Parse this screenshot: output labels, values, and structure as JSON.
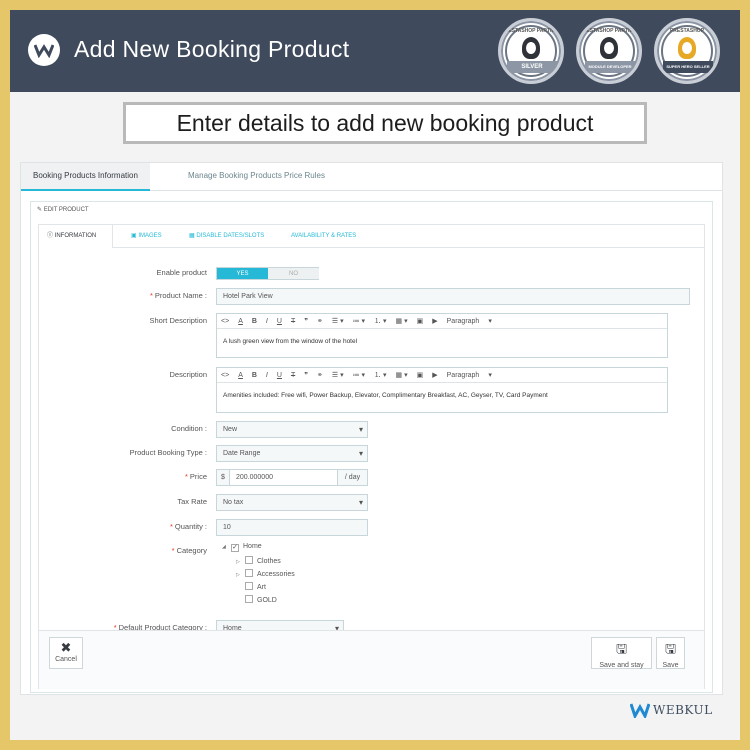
{
  "header": {
    "title": "Add New Booking Product",
    "badges": [
      {
        "top": "PRESTASHOP PARTNER",
        "ribbon": "SILVER"
      },
      {
        "top": "PRESTASHOP PARTNER",
        "ribbon": "MODULE DEVELOPER"
      },
      {
        "top": "PRESTASHOP",
        "ribbon": "SUPER HERO SELLER"
      }
    ]
  },
  "subtitle": "Enter details to add new booking product",
  "top_tabs": [
    "Booking Products Information",
    "Manage Booking Products Price Rules"
  ],
  "edit_heading": "✎ EDIT PRODUCT",
  "sub_tabs": [
    "ⓘ INFORMATION",
    "▣ IMAGES",
    "▦ DISABLE DATES/SLOTS",
    "AVAILABILITY & RATES"
  ],
  "form": {
    "enable_label": "Enable product",
    "enable_yes": "YES",
    "enable_no": "NO",
    "name_label": "Product Name :",
    "name_value": "Hotel Park View",
    "short_desc_label": "Short Description",
    "short_desc_value": "A lush green view from the window of the hotel",
    "desc_label": "Description",
    "desc_value": "Amenities included: Free wifi, Power Backup, Elevator, Complimentary Breakfast, AC, Geyser, TV, Card Payment",
    "editor_paragraph": "Paragraph",
    "condition_label": "Condition :",
    "condition_value": "New",
    "booking_type_label": "Product Booking Type :",
    "booking_type_value": "Date Range",
    "price_label": "Price",
    "price_currency": "$",
    "price_value": "200.000000",
    "price_unit": "/ day",
    "tax_label": "Tax Rate",
    "tax_value": "No tax",
    "quantity_label": "Quantity :",
    "quantity_value": "10",
    "category_label": "Category",
    "categories": [
      {
        "name": "Home",
        "checked": true
      },
      {
        "name": "Clothes",
        "checked": false
      },
      {
        "name": "Accessories",
        "checked": false
      },
      {
        "name": "Art",
        "checked": false
      },
      {
        "name": "GOLD",
        "checked": false
      }
    ],
    "default_cat_label": "Default Product Category :",
    "default_cat_value": "Home"
  },
  "footer": {
    "cancel": "Cancel",
    "save_stay": "Save and stay",
    "save": "Save"
  },
  "brand": "WEBKUL",
  "colors": {
    "outer_border": "#e5c76a",
    "header_bg": "#3f4a5c",
    "accent": "#25b9d7",
    "required": "#e4371b"
  }
}
